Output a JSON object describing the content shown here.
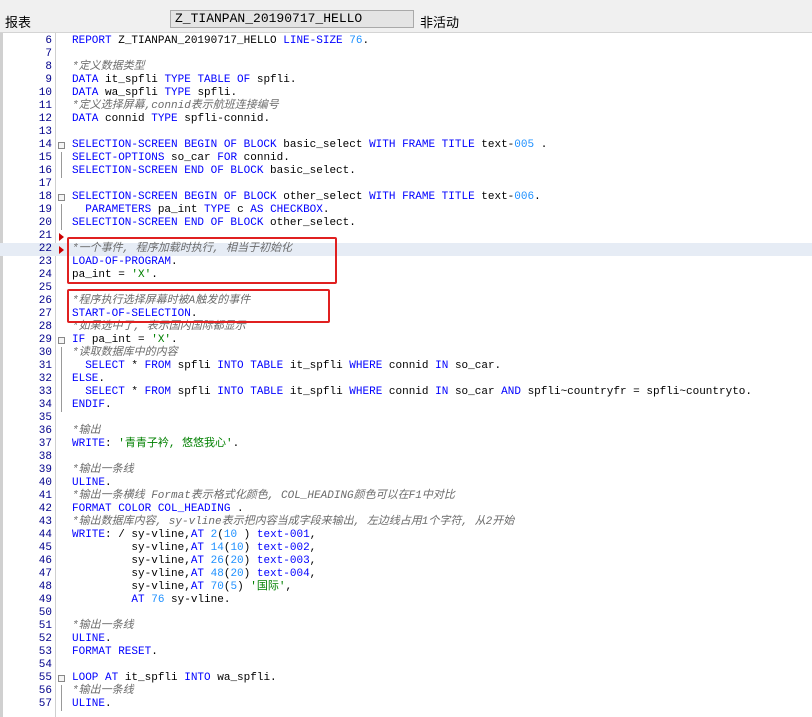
{
  "header": {
    "type_label": "报表",
    "program_name": "Z_TIANPAN_20190717_HELLO",
    "status_text": "非活动"
  },
  "lines": [
    {
      "n": "6",
      "m": "",
      "segs": [
        [
          "kw",
          "REPORT "
        ],
        [
          "",
          "Z_TIANPAN_20190717_HELLO "
        ],
        [
          "kw",
          "LINE-SIZE "
        ],
        [
          "nm",
          "76"
        ],
        [
          "",
          "."
        ]
      ]
    },
    {
      "n": "7",
      "m": "",
      "segs": []
    },
    {
      "n": "8",
      "m": "",
      "segs": [
        [
          "cm",
          "*定义数据类型"
        ]
      ]
    },
    {
      "n": "9",
      "m": "",
      "segs": [
        [
          "kw",
          "DATA "
        ],
        [
          "",
          "it_spfli "
        ],
        [
          "kw",
          "TYPE TABLE OF "
        ],
        [
          "",
          "spfli."
        ]
      ]
    },
    {
      "n": "10",
      "m": "",
      "segs": [
        [
          "kw",
          "DATA "
        ],
        [
          "",
          "wa_spfli "
        ],
        [
          "kw",
          "TYPE "
        ],
        [
          "",
          "spfli."
        ]
      ]
    },
    {
      "n": "11",
      "m": "",
      "segs": [
        [
          "cm",
          "*定义选择屏幕,connid表示航班连接编号"
        ]
      ]
    },
    {
      "n": "12",
      "m": "",
      "segs": [
        [
          "kw",
          "DATA "
        ],
        [
          "",
          "connid "
        ],
        [
          "kw",
          "TYPE "
        ],
        [
          "",
          "spfli-connid."
        ]
      ]
    },
    {
      "n": "13",
      "m": "",
      "segs": []
    },
    {
      "n": "14",
      "m": "box",
      "segs": [
        [
          "kw",
          "SELECTION-SCREEN BEGIN OF BLOCK "
        ],
        [
          "",
          "basic_select "
        ],
        [
          "kw",
          "WITH FRAME TITLE "
        ],
        [
          "",
          "text-"
        ],
        [
          "nm",
          "005"
        ],
        [
          "",
          " ."
        ]
      ]
    },
    {
      "n": "15",
      "m": "bar",
      "segs": [
        [
          "kw",
          "SELECT-OPTIONS "
        ],
        [
          "",
          "so_car "
        ],
        [
          "kw",
          "FOR "
        ],
        [
          "",
          "connid."
        ]
      ]
    },
    {
      "n": "16",
      "m": "bar",
      "segs": [
        [
          "kw",
          "SELECTION-SCREEN END OF BLOCK "
        ],
        [
          "",
          "basic_select."
        ]
      ]
    },
    {
      "n": "17",
      "m": "",
      "segs": []
    },
    {
      "n": "18",
      "m": "box",
      "segs": [
        [
          "kw",
          "SELECTION-SCREEN BEGIN OF BLOCK "
        ],
        [
          "",
          "other_select "
        ],
        [
          "kw",
          "WITH FRAME TITLE "
        ],
        [
          "",
          "text-"
        ],
        [
          "nm",
          "006"
        ],
        [
          "",
          "."
        ]
      ]
    },
    {
      "n": "19",
      "m": "bar",
      "segs": [
        [
          "",
          "  "
        ],
        [
          "kw",
          "PARAMETERS "
        ],
        [
          "",
          "pa_int "
        ],
        [
          "kw",
          "TYPE "
        ],
        [
          "",
          "c "
        ],
        [
          "kw",
          "AS CHECKBOX"
        ],
        [
          "",
          "."
        ]
      ]
    },
    {
      "n": "20",
      "m": "bar",
      "segs": [
        [
          "kw",
          "SELECTION-SCREEN END OF BLOCK "
        ],
        [
          "",
          "other_select."
        ]
      ]
    },
    {
      "n": "21",
      "m": "tri",
      "segs": []
    },
    {
      "n": "22",
      "m": "tri",
      "hl": true,
      "segs": [
        [
          "cm",
          "*一个事件, 程序加载时执行, 相当于初始化"
        ]
      ]
    },
    {
      "n": "23",
      "m": "",
      "segs": [
        [
          "kw",
          "LOAD-OF-PROGRAM"
        ],
        [
          "",
          "."
        ]
      ]
    },
    {
      "n": "24",
      "m": "",
      "segs": [
        [
          "",
          "pa_int = "
        ],
        [
          "st",
          "'X'"
        ],
        [
          "",
          "."
        ]
      ]
    },
    {
      "n": "25",
      "m": "",
      "segs": []
    },
    {
      "n": "26",
      "m": "",
      "segs": [
        [
          "cm",
          "*程序执行选择屏幕时被A触发的事件"
        ]
      ]
    },
    {
      "n": "27",
      "m": "",
      "segs": [
        [
          "kw",
          "START-OF-SELECTION"
        ],
        [
          "",
          "."
        ]
      ]
    },
    {
      "n": "28",
      "m": "",
      "segs": [
        [
          "cm",
          "*如果选中了, 表示国内国际都显示"
        ]
      ]
    },
    {
      "n": "29",
      "m": "box",
      "segs": [
        [
          "kw",
          "IF "
        ],
        [
          "",
          "pa_int = "
        ],
        [
          "st",
          "'X'"
        ],
        [
          "",
          "."
        ]
      ]
    },
    {
      "n": "30",
      "m": "bar",
      "segs": [
        [
          "cm",
          "*读取数据库中的内容"
        ]
      ]
    },
    {
      "n": "31",
      "m": "bar",
      "segs": [
        [
          "",
          "  "
        ],
        [
          "kw",
          "SELECT "
        ],
        [
          "",
          "* "
        ],
        [
          "kw",
          "FROM "
        ],
        [
          "",
          "spfli "
        ],
        [
          "kw",
          "INTO TABLE "
        ],
        [
          "",
          "it_spfli "
        ],
        [
          "kw",
          "WHERE "
        ],
        [
          "",
          "connid "
        ],
        [
          "kw",
          "IN "
        ],
        [
          "",
          "so_car."
        ]
      ]
    },
    {
      "n": "32",
      "m": "bar",
      "segs": [
        [
          "kw",
          "ELSE"
        ],
        [
          "",
          "."
        ]
      ]
    },
    {
      "n": "33",
      "m": "bar",
      "segs": [
        [
          "",
          "  "
        ],
        [
          "kw",
          "SELECT "
        ],
        [
          "",
          "* "
        ],
        [
          "kw",
          "FROM "
        ],
        [
          "",
          "spfli "
        ],
        [
          "kw",
          "INTO TABLE "
        ],
        [
          "",
          "it_spfli "
        ],
        [
          "kw",
          "WHERE "
        ],
        [
          "",
          "connid "
        ],
        [
          "kw",
          "IN "
        ],
        [
          "",
          "so_car "
        ],
        [
          "kw",
          "AND "
        ],
        [
          "",
          "spfli~countryfr = spfli~countryto."
        ]
      ]
    },
    {
      "n": "34",
      "m": "bar",
      "segs": [
        [
          "kw",
          "ENDIF"
        ],
        [
          "",
          "."
        ]
      ]
    },
    {
      "n": "35",
      "m": "",
      "segs": []
    },
    {
      "n": "36",
      "m": "",
      "segs": [
        [
          "cm",
          "*输出"
        ]
      ]
    },
    {
      "n": "37",
      "m": "",
      "segs": [
        [
          "kw",
          "WRITE"
        ],
        [
          "",
          ": "
        ],
        [
          "st",
          "'青青子衿, 悠悠我心'"
        ],
        [
          "",
          "."
        ]
      ]
    },
    {
      "n": "38",
      "m": "",
      "segs": []
    },
    {
      "n": "39",
      "m": "",
      "segs": [
        [
          "cm",
          "*输出一条线"
        ]
      ]
    },
    {
      "n": "40",
      "m": "",
      "segs": [
        [
          "kw",
          "ULINE"
        ],
        [
          "",
          "."
        ]
      ]
    },
    {
      "n": "41",
      "m": "",
      "segs": [
        [
          "cm",
          "*输出一条横线 Format表示格式化颜色, COL_HEADING颜色可以在F1中对比"
        ]
      ]
    },
    {
      "n": "42",
      "m": "",
      "segs": [
        [
          "kw",
          "FORMAT COLOR COL_HEADING "
        ],
        [
          "",
          "."
        ]
      ]
    },
    {
      "n": "43",
      "m": "",
      "segs": [
        [
          "cm",
          "*输出数据库内容, sy-vline表示把内容当成字段来输出, 左边线占用1个字符, 从2开始"
        ]
      ]
    },
    {
      "n": "44",
      "m": "",
      "segs": [
        [
          "kw",
          "WRITE"
        ],
        [
          "",
          ": / sy-vline,"
        ],
        [
          "kw",
          "AT "
        ],
        [
          "nm",
          "2"
        ],
        [
          "",
          "("
        ],
        [
          "nm",
          "10"
        ],
        [
          "",
          " ) "
        ],
        [
          "kw",
          "text-001"
        ],
        [
          "",
          ","
        ]
      ]
    },
    {
      "n": "45",
      "m": "",
      "segs": [
        [
          "",
          "         sy-vline,"
        ],
        [
          "kw",
          "AT "
        ],
        [
          "nm",
          "14"
        ],
        [
          "",
          "("
        ],
        [
          "nm",
          "10"
        ],
        [
          "",
          ") "
        ],
        [
          "kw",
          "text-002"
        ],
        [
          "",
          ","
        ]
      ]
    },
    {
      "n": "46",
      "m": "",
      "segs": [
        [
          "",
          "         sy-vline,"
        ],
        [
          "kw",
          "AT "
        ],
        [
          "nm",
          "26"
        ],
        [
          "",
          "("
        ],
        [
          "nm",
          "20"
        ],
        [
          "",
          ") "
        ],
        [
          "kw",
          "text-003"
        ],
        [
          "",
          ","
        ]
      ]
    },
    {
      "n": "47",
      "m": "",
      "segs": [
        [
          "",
          "         sy-vline,"
        ],
        [
          "kw",
          "AT "
        ],
        [
          "nm",
          "48"
        ],
        [
          "",
          "("
        ],
        [
          "nm",
          "20"
        ],
        [
          "",
          ") "
        ],
        [
          "kw",
          "text-004"
        ],
        [
          "",
          ","
        ]
      ]
    },
    {
      "n": "48",
      "m": "",
      "segs": [
        [
          "",
          "         sy-vline,"
        ],
        [
          "kw",
          "AT "
        ],
        [
          "nm",
          "70"
        ],
        [
          "",
          "("
        ],
        [
          "nm",
          "5"
        ],
        [
          "",
          ") "
        ],
        [
          "st",
          "'国际'"
        ],
        [
          "",
          ","
        ]
      ]
    },
    {
      "n": "49",
      "m": "",
      "segs": [
        [
          "",
          "         "
        ],
        [
          "kw",
          "AT "
        ],
        [
          "nm",
          "76"
        ],
        [
          "",
          " sy-vline."
        ]
      ]
    },
    {
      "n": "50",
      "m": "",
      "segs": []
    },
    {
      "n": "51",
      "m": "",
      "segs": [
        [
          "cm",
          "*输出一条线"
        ]
      ]
    },
    {
      "n": "52",
      "m": "",
      "segs": [
        [
          "kw",
          "ULINE"
        ],
        [
          "",
          "."
        ]
      ]
    },
    {
      "n": "53",
      "m": "",
      "segs": [
        [
          "kw",
          "FORMAT RESET"
        ],
        [
          "",
          "."
        ]
      ]
    },
    {
      "n": "54",
      "m": "",
      "segs": []
    },
    {
      "n": "55",
      "m": "box",
      "segs": [
        [
          "kw",
          "LOOP AT "
        ],
        [
          "",
          "it_spfli "
        ],
        [
          "kw",
          "INTO "
        ],
        [
          "",
          "wa_spfli."
        ]
      ]
    },
    {
      "n": "56",
      "m": "bar",
      "segs": [
        [
          "cm",
          "*输出一条线"
        ]
      ]
    },
    {
      "n": "57",
      "m": "bar",
      "segs": [
        [
          "kw",
          "ULINE"
        ],
        [
          "",
          "."
        ]
      ]
    }
  ]
}
